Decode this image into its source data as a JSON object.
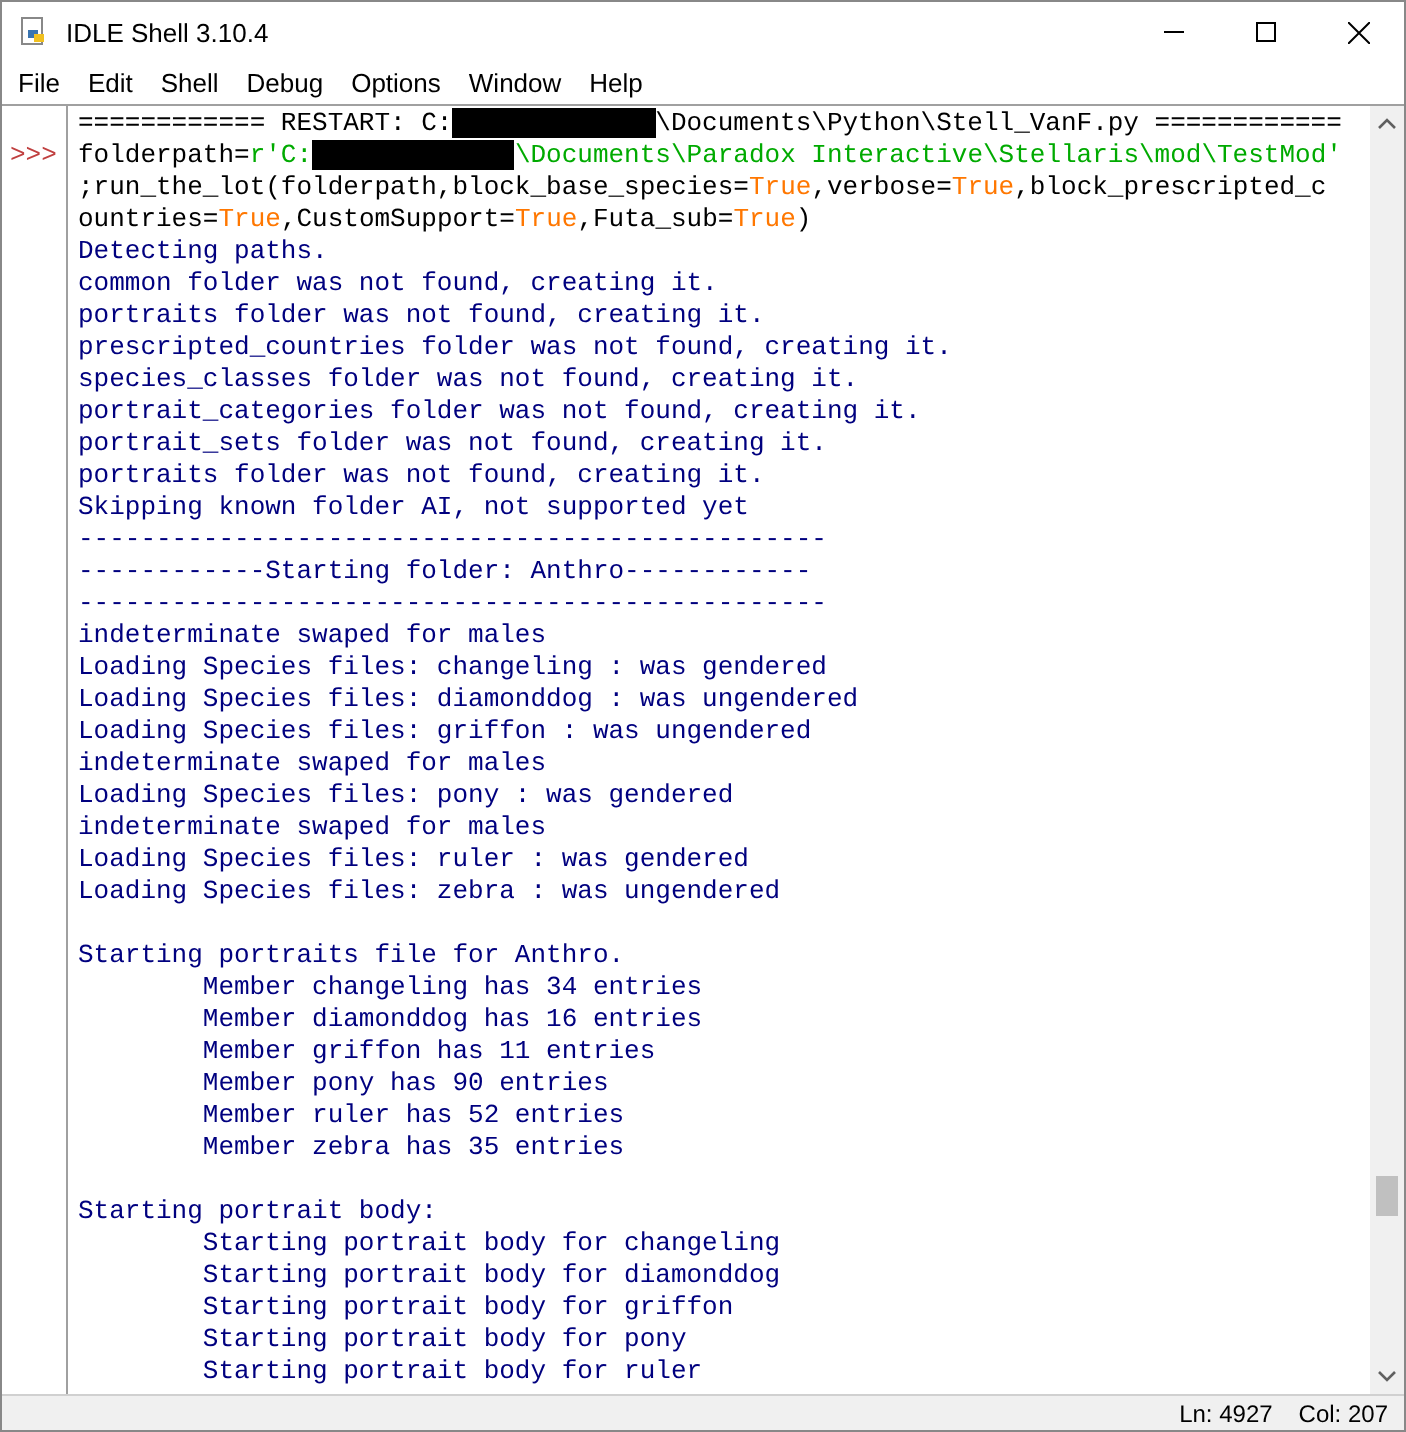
{
  "window": {
    "title": "IDLE Shell 3.10.4"
  },
  "menu": [
    "File",
    "Edit",
    "Shell",
    "Debug",
    "Options",
    "Window",
    "Help"
  ],
  "shell": {
    "lines": [
      {
        "kind": "text",
        "segments": [
          {
            "kind": "code",
            "text": "============ RESTART: C:"
          },
          {
            "kind": "redaction"
          },
          {
            "kind": "code",
            "text": "\\Documents\\Python\\Stell_VanF.py ============"
          }
        ]
      },
      {
        "kind": "text",
        "prompt": ">>>",
        "segments": [
          {
            "kind": "code",
            "text": "folderpath="
          },
          {
            "kind": "string",
            "text": "r'C:"
          },
          {
            "kind": "redaction"
          },
          {
            "kind": "string",
            "text": "\\Documents\\Paradox Interactive\\Stellaris\\mod\\TestMod'"
          }
        ]
      },
      {
        "kind": "text",
        "segments": [
          {
            "kind": "code",
            "text": ";run_the_lot(folderpath,block_base_species="
          },
          {
            "kind": "keyword",
            "text": "True"
          },
          {
            "kind": "code",
            "text": ",verbose="
          },
          {
            "kind": "keyword",
            "text": "True"
          },
          {
            "kind": "code",
            "text": ",block_prescripted_c"
          }
        ]
      },
      {
        "kind": "text",
        "segments": [
          {
            "kind": "code",
            "text": "ountries="
          },
          {
            "kind": "keyword",
            "text": "True"
          },
          {
            "kind": "code",
            "text": ",CustomSupport="
          },
          {
            "kind": "keyword",
            "text": "True"
          },
          {
            "kind": "code",
            "text": ",Futa_sub="
          },
          {
            "kind": "keyword",
            "text": "True"
          },
          {
            "kind": "code",
            "text": ")"
          }
        ]
      },
      {
        "kind": "text",
        "segments": [
          {
            "kind": "output",
            "text": "Detecting paths."
          }
        ]
      },
      {
        "kind": "text",
        "segments": [
          {
            "kind": "output",
            "text": "common folder was not found, creating it."
          }
        ]
      },
      {
        "kind": "text",
        "segments": [
          {
            "kind": "output",
            "text": "portraits folder was not found, creating it."
          }
        ]
      },
      {
        "kind": "text",
        "segments": [
          {
            "kind": "output",
            "text": "prescripted_countries folder was not found, creating it."
          }
        ]
      },
      {
        "kind": "text",
        "segments": [
          {
            "kind": "output",
            "text": "species_classes folder was not found, creating it."
          }
        ]
      },
      {
        "kind": "text",
        "segments": [
          {
            "kind": "output",
            "text": "portrait_categories folder was not found, creating it."
          }
        ]
      },
      {
        "kind": "text",
        "segments": [
          {
            "kind": "output",
            "text": "portrait_sets folder was not found, creating it."
          }
        ]
      },
      {
        "kind": "text",
        "segments": [
          {
            "kind": "output",
            "text": "portraits folder was not found, creating it."
          }
        ]
      },
      {
        "kind": "text",
        "segments": [
          {
            "kind": "output",
            "text": "Skipping known folder AI, not supported yet"
          }
        ]
      },
      {
        "kind": "text",
        "segments": [
          {
            "kind": "output",
            "text": "------------------------------------------------"
          }
        ]
      },
      {
        "kind": "text",
        "segments": [
          {
            "kind": "output",
            "text": "------------Starting folder: Anthro------------"
          }
        ]
      },
      {
        "kind": "text",
        "segments": [
          {
            "kind": "output",
            "text": "------------------------------------------------"
          }
        ]
      },
      {
        "kind": "text",
        "segments": [
          {
            "kind": "output",
            "text": "indeterminate swaped for males"
          }
        ]
      },
      {
        "kind": "text",
        "segments": [
          {
            "kind": "output",
            "text": "Loading Species files: changeling : was gendered"
          }
        ]
      },
      {
        "kind": "text",
        "segments": [
          {
            "kind": "output",
            "text": "Loading Species files: diamonddog : was ungendered"
          }
        ]
      },
      {
        "kind": "text",
        "segments": [
          {
            "kind": "output",
            "text": "Loading Species files: griffon : was ungendered"
          }
        ]
      },
      {
        "kind": "text",
        "segments": [
          {
            "kind": "output",
            "text": "indeterminate swaped for males"
          }
        ]
      },
      {
        "kind": "text",
        "segments": [
          {
            "kind": "output",
            "text": "Loading Species files: pony : was gendered"
          }
        ]
      },
      {
        "kind": "text",
        "segments": [
          {
            "kind": "output",
            "text": "indeterminate swaped for males"
          }
        ]
      },
      {
        "kind": "text",
        "segments": [
          {
            "kind": "output",
            "text": "Loading Species files: ruler : was gendered"
          }
        ]
      },
      {
        "kind": "text",
        "segments": [
          {
            "kind": "output",
            "text": "Loading Species files: zebra : was ungendered"
          }
        ]
      },
      {
        "kind": "blank"
      },
      {
        "kind": "text",
        "segments": [
          {
            "kind": "output",
            "text": "Starting portraits file for Anthro."
          }
        ]
      },
      {
        "kind": "text",
        "indented": true,
        "segments": [
          {
            "kind": "output",
            "text": "Member changeling has 34 entries"
          }
        ]
      },
      {
        "kind": "text",
        "indented": true,
        "segments": [
          {
            "kind": "output",
            "text": "Member diamonddog has 16 entries"
          }
        ]
      },
      {
        "kind": "text",
        "indented": true,
        "segments": [
          {
            "kind": "output",
            "text": "Member griffon has 11 entries"
          }
        ]
      },
      {
        "kind": "text",
        "indented": true,
        "segments": [
          {
            "kind": "output",
            "text": "Member pony has 90 entries"
          }
        ]
      },
      {
        "kind": "text",
        "indented": true,
        "segments": [
          {
            "kind": "output",
            "text": "Member ruler has 52 entries"
          }
        ]
      },
      {
        "kind": "text",
        "indented": true,
        "segments": [
          {
            "kind": "output",
            "text": "Member zebra has 35 entries"
          }
        ]
      },
      {
        "kind": "blank"
      },
      {
        "kind": "text",
        "segments": [
          {
            "kind": "output",
            "text": "Starting portrait body:"
          }
        ]
      },
      {
        "kind": "text",
        "indented": true,
        "segments": [
          {
            "kind": "output",
            "text": "Starting portrait body for changeling"
          }
        ]
      },
      {
        "kind": "text",
        "indented": true,
        "segments": [
          {
            "kind": "output",
            "text": "Starting portrait body for diamonddog"
          }
        ]
      },
      {
        "kind": "text",
        "indented": true,
        "segments": [
          {
            "kind": "output",
            "text": "Starting portrait body for griffon"
          }
        ]
      },
      {
        "kind": "text",
        "indented": true,
        "segments": [
          {
            "kind": "output",
            "text": "Starting portrait body for pony"
          }
        ]
      },
      {
        "kind": "text",
        "indented": true,
        "segments": [
          {
            "kind": "output",
            "text": "Starting portrait body for ruler"
          }
        ]
      }
    ]
  },
  "status_bar": {
    "line": "Ln: 4927",
    "column": "Col: 207"
  }
}
